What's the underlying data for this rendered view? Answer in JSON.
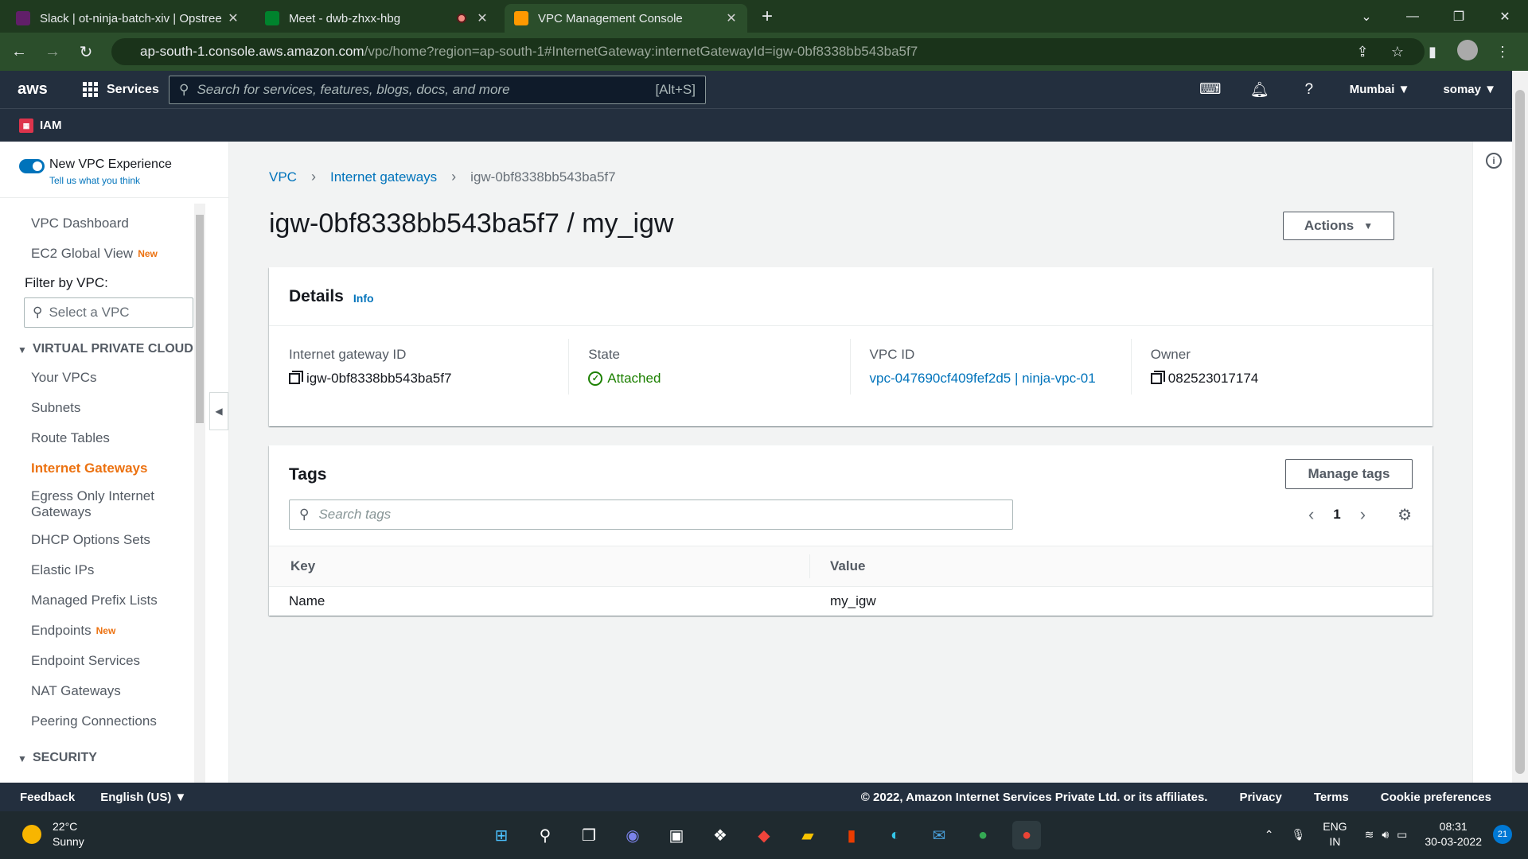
{
  "browser": {
    "tabs": [
      {
        "title": "Slack | ot-ninja-batch-xiv | Opstree",
        "color": "#611f69"
      },
      {
        "title": "Meet - dwb-zhxx-hbg",
        "color": "#00832d"
      },
      {
        "title": "VPC Management Console",
        "color": "#f90"
      }
    ],
    "url_host": "ap-south-1.console.aws.amazon.com",
    "url_path": "/vpc/home?region=ap-south-1#InternetGateway:internetGatewayId=igw-0bf8338bb543ba5f7"
  },
  "awsnav": {
    "logo": "aws",
    "services": "Services",
    "search_placeholder": "Search for services, features, blogs, docs, and more",
    "search_shortcut": "[Alt+S]",
    "region": "Mumbai",
    "user": "somay",
    "favorite": "IAM"
  },
  "sidebar": {
    "toggle_title": "New VPC Experience",
    "toggle_sub": "Tell us what you think",
    "vpc_dashboard": "VPC Dashboard",
    "ec2_global": "EC2 Global View",
    "new_badge": "New",
    "filter_label": "Filter by VPC:",
    "filter_placeholder": "Select a VPC",
    "section_vpc": "VIRTUAL PRIVATE CLOUD",
    "items": [
      "Your VPCs",
      "Subnets",
      "Route Tables",
      "Internet Gateways",
      "Egress Only Internet Gateways",
      "DHCP Options Sets",
      "Elastic IPs",
      "Managed Prefix Lists",
      "Endpoints",
      "Endpoint Services",
      "NAT Gateways",
      "Peering Connections"
    ],
    "section_security": "SECURITY"
  },
  "breadcrumb": {
    "vpc": "VPC",
    "igw": "Internet gateways",
    "current": "igw-0bf8338bb543ba5f7"
  },
  "page_title": "igw-0bf8338bb543ba5f7 / my_igw",
  "actions_label": "Actions",
  "details": {
    "heading": "Details",
    "info": "Info",
    "igw_label": "Internet gateway ID",
    "igw_value": "igw-0bf8338bb543ba5f7",
    "state_label": "State",
    "state_value": "Attached",
    "vpc_label": "VPC ID",
    "vpc_value": "vpc-047690cf409fef2d5 | ninja-vpc-01",
    "owner_label": "Owner",
    "owner_value": "082523017174"
  },
  "tags": {
    "heading": "Tags",
    "manage": "Manage tags",
    "search_placeholder": "Search tags",
    "page": "1",
    "col_key": "Key",
    "col_value": "Value",
    "rows": [
      {
        "key": "Name",
        "value": "my_igw"
      }
    ]
  },
  "footer": {
    "feedback": "Feedback",
    "language": "English (US)",
    "copyright": "© 2022, Amazon Internet Services Private Ltd. or its affiliates.",
    "privacy": "Privacy",
    "terms": "Terms",
    "cookies": "Cookie preferences"
  },
  "taskbar": {
    "temp": "22°C",
    "condition": "Sunny",
    "lang1": "ENG",
    "lang2": "IN",
    "time": "08:31",
    "date": "30-03-2022",
    "notifications": "21"
  },
  "colors": {
    "accent": "#0073bb",
    "active_nav": "#ec7211",
    "success": "#1d8102",
    "aws_nav": "#232f3e"
  }
}
